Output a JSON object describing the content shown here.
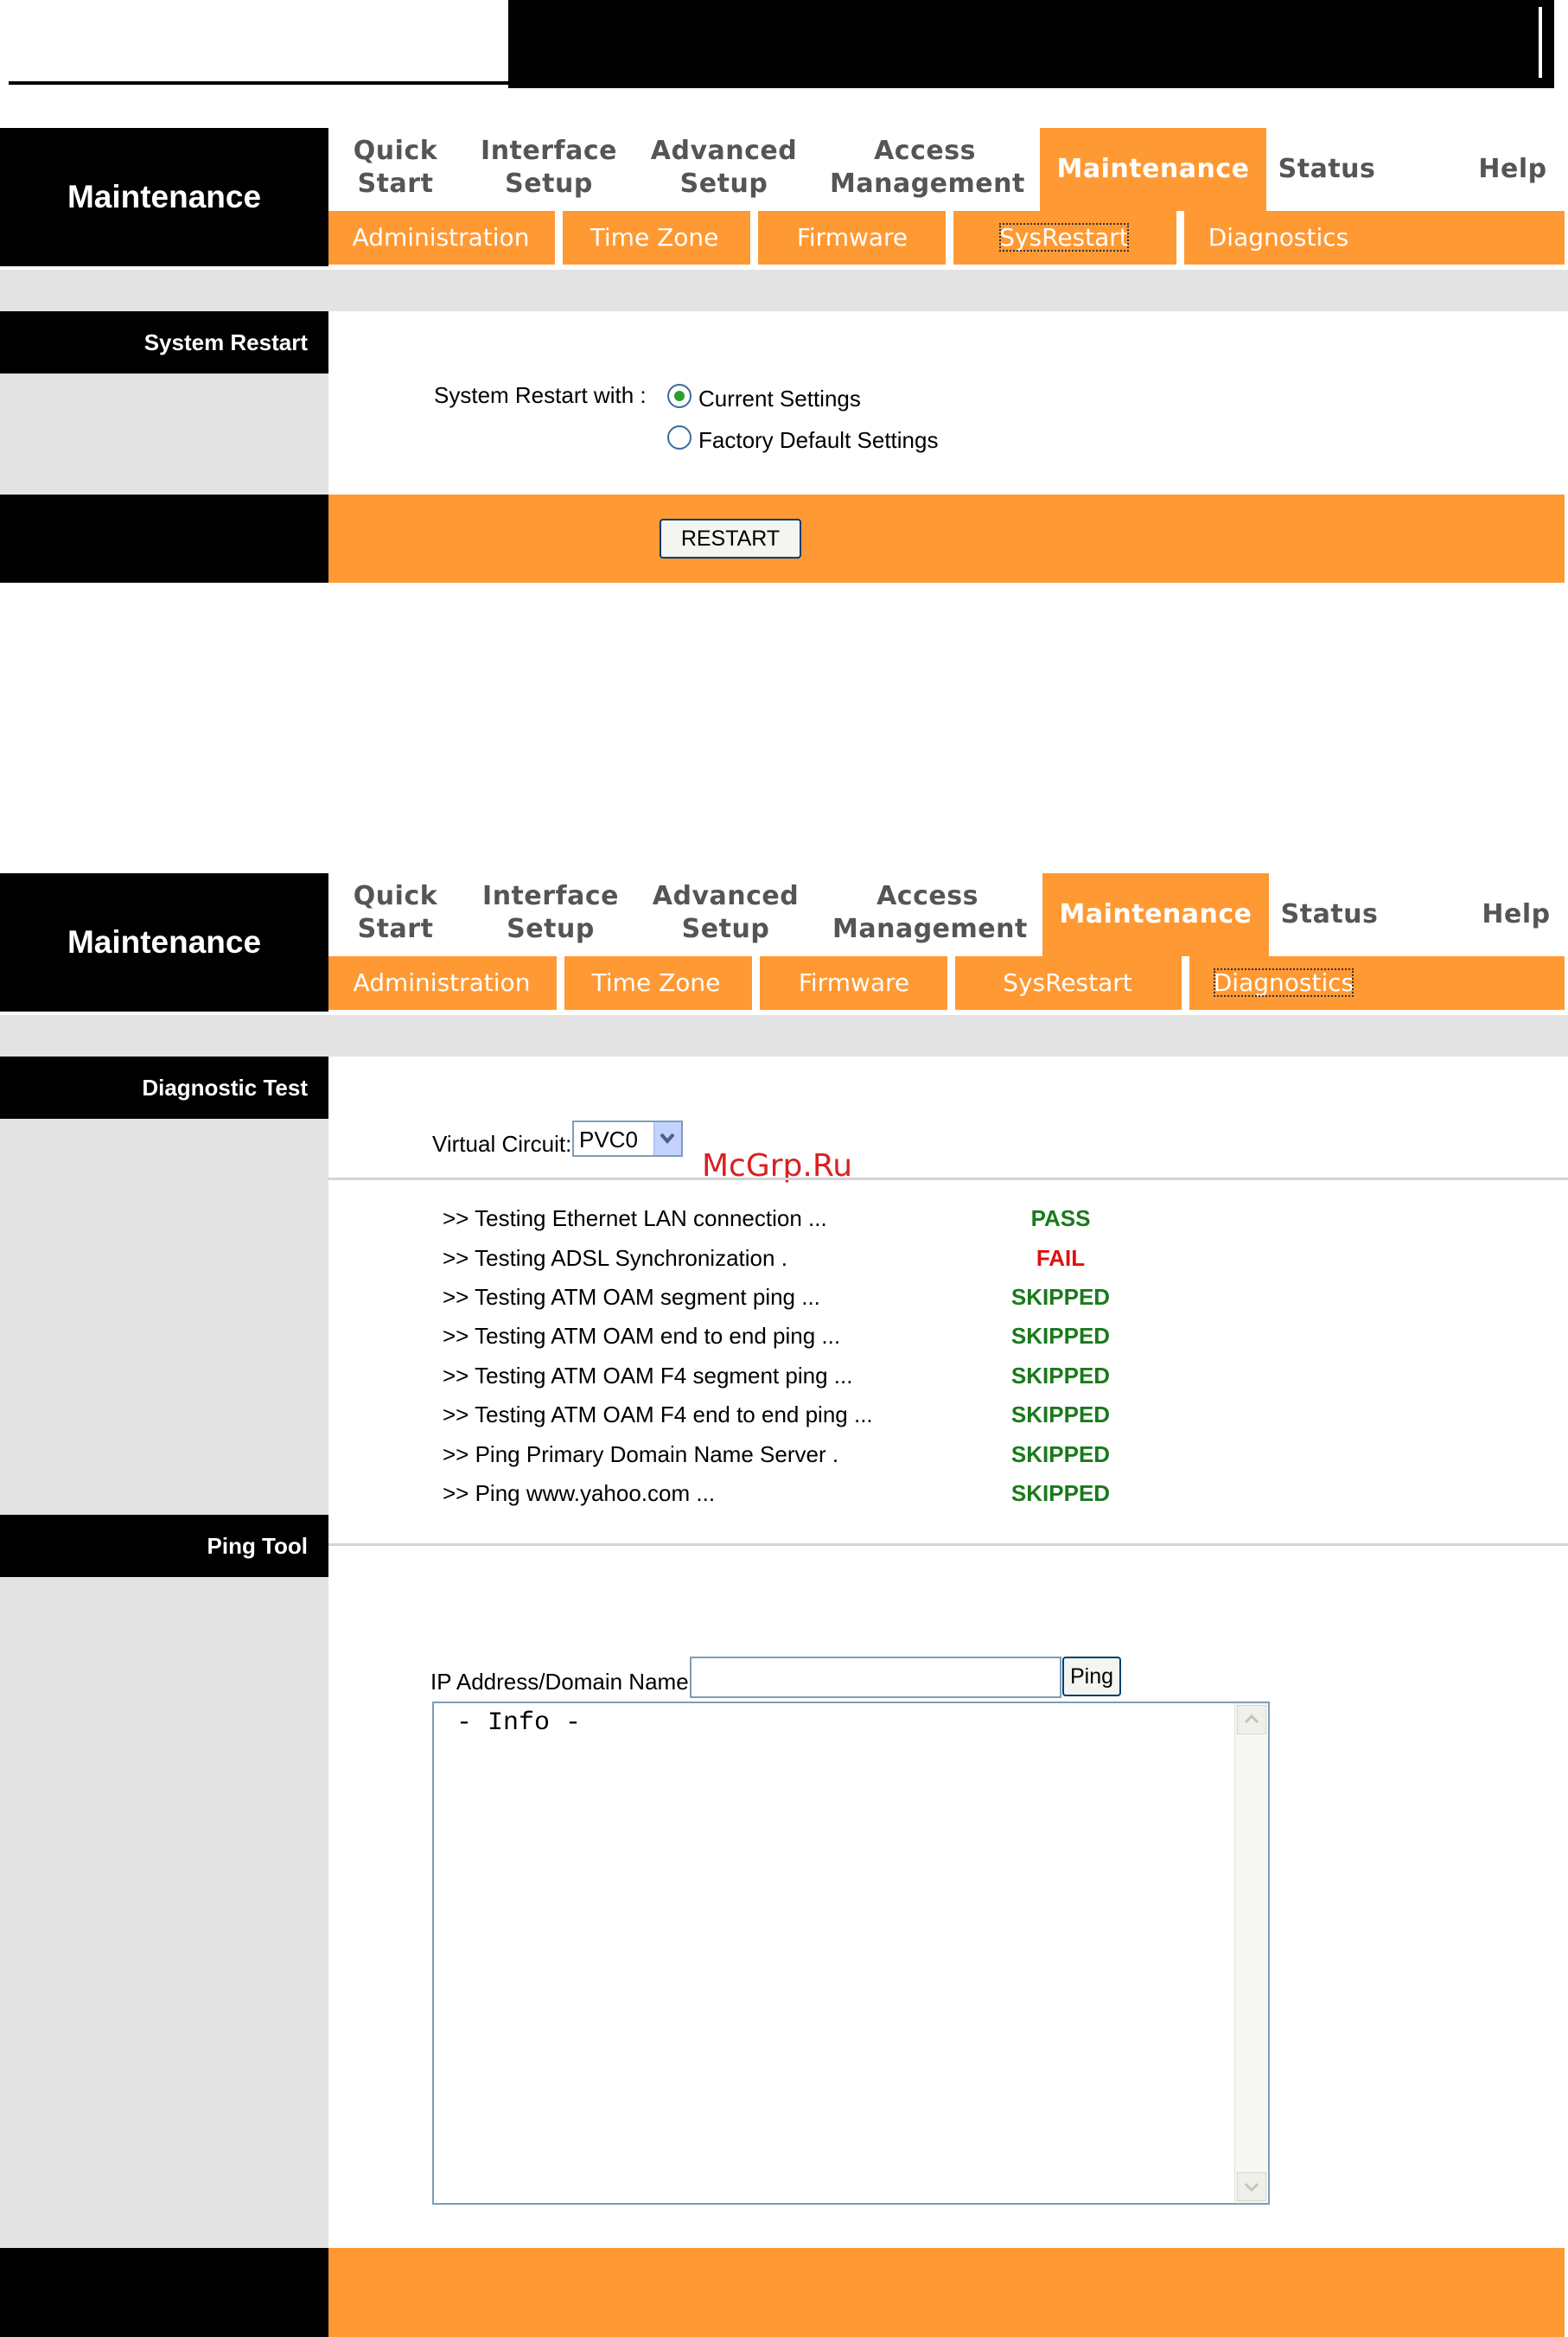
{
  "nav": {
    "title": "Maintenance",
    "tabs": [
      {
        "line1": "Quick",
        "line2": "Start"
      },
      {
        "line1": "Interface",
        "line2": "Setup"
      },
      {
        "line1": "Advanced",
        "line2": "Setup"
      },
      {
        "line1": "Access",
        "line2": "Management"
      },
      {
        "label": "Maintenance"
      },
      {
        "label": "Status"
      },
      {
        "label": "Help"
      }
    ],
    "subtabs": [
      "Administration",
      "Time Zone",
      "Firmware",
      "SysRestart",
      "Diagnostics"
    ]
  },
  "restart": {
    "section_label": "System Restart",
    "field_label": "System Restart with :",
    "options": [
      "Current Settings",
      "Factory Default Settings"
    ],
    "selected": "Current Settings",
    "button": "RESTART"
  },
  "diagnostics": {
    "section_label": "Diagnostic Test",
    "vc_label": "Virtual Circuit:",
    "vc_value": "PVC0",
    "watermark": "McGrp.Ru",
    "tests": [
      {
        "name": ">> Testing Ethernet LAN connection ...",
        "result": "PASS"
      },
      {
        "name": ">> Testing ADSL Synchronization .",
        "result": "FAIL"
      },
      {
        "name": ">> Testing ATM OAM segment ping ...",
        "result": "SKIPPED"
      },
      {
        "name": ">> Testing ATM OAM end to end ping ...",
        "result": "SKIPPED"
      },
      {
        "name": ">> Testing ATM OAM F4 segment ping ...",
        "result": "SKIPPED"
      },
      {
        "name": ">> Testing ATM OAM F4 end to end ping ...",
        "result": "SKIPPED"
      },
      {
        "name": ">> Ping Primary Domain Name Server .",
        "result": "SKIPPED"
      },
      {
        "name": ">> Ping www.yahoo.com ...",
        "result": "SKIPPED"
      }
    ]
  },
  "ping": {
    "section_label": "Ping Tool",
    "field_label": "IP Address/Domain Name:",
    "field_value": "",
    "button": "Ping",
    "output": "- Info -"
  },
  "colors": {
    "accent": "#ff9933",
    "pass": "#1a7a1a",
    "fail": "#e01010"
  }
}
